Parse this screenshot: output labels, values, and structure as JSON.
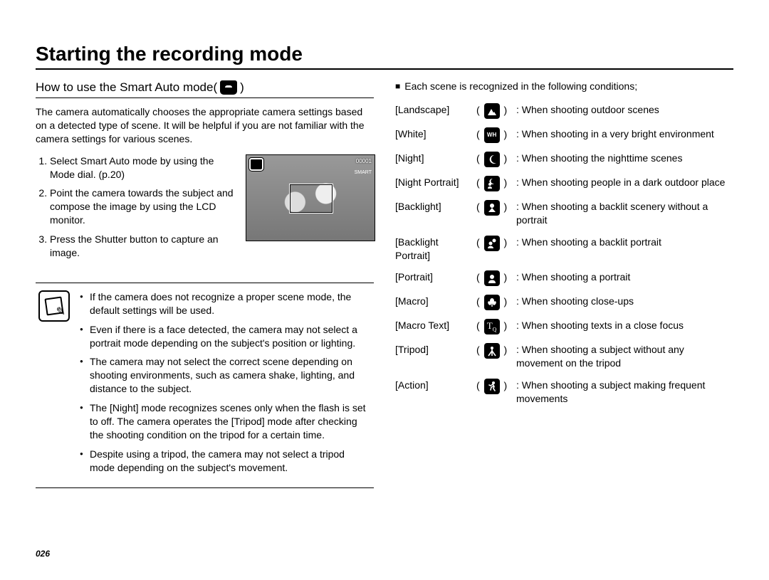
{
  "page_number": "026",
  "title": "Starting the recording mode",
  "left": {
    "subhead_prefix": "How to use the Smart Auto mode(",
    "subhead_suffix": ")",
    "intro": "The camera automatically chooses the appropriate camera settings based on a detected type of scene. It will be helpful if you are not familiar with the camera settings for various scenes.",
    "steps": [
      "Select Smart Auto mode by using the Mode dial. (p.20)",
      "Point the camera towards the subject and compose the image by using the LCD monitor.",
      "Press the Shutter button to capture an image."
    ],
    "lcd": {
      "top_left_icon": "smart-auto-icon",
      "top_right_text": "00001",
      "right_label": "SMART"
    },
    "notes": [
      "If the camera does not recognize a proper scene mode, the default settings will be used.",
      "Even if there is a face detected, the camera may not select a portrait mode depending on the subject's position or lighting.",
      "The camera may not select the correct scene depending on shooting environments, such as camera shake, lighting, and distance to the subject.",
      "The [Night] mode recognizes scenes only when the flash is set to off. The camera operates the [Tripod] mode after checking the shooting condition on the tripod for a certain time.",
      "Despite using a tripod, the camera may not select a tripod mode depending on the subject's movement."
    ]
  },
  "right": {
    "heading": "Each scene is recognized in the following conditions;",
    "scenes": [
      {
        "label": "[Landscape]",
        "icon": "landscape",
        "desc": "When shooting outdoor scenes"
      },
      {
        "label": "[White]",
        "icon": "white",
        "desc": "When shooting in a very bright environment"
      },
      {
        "label": "[Night]",
        "icon": "night",
        "desc": "When shooting the nighttime scenes"
      },
      {
        "label": "[Night Portrait]",
        "icon": "night-portrait",
        "desc": "When shooting people in a dark outdoor place"
      },
      {
        "label": "[Backlight]",
        "icon": "backlight",
        "desc": "When shooting a backlit scenery without a portrait"
      },
      {
        "label": "[Backlight Portrait]",
        "icon": "backlight-portrait",
        "desc": "When shooting a backlit portrait"
      },
      {
        "label": "[Portrait]",
        "icon": "portrait",
        "desc": "When shooting a portrait"
      },
      {
        "label": "[Macro]",
        "icon": "macro",
        "desc": "When shooting close-ups"
      },
      {
        "label": "[Macro Text]",
        "icon": "macro-text",
        "desc": "When shooting texts in a close focus"
      },
      {
        "label": "[Tripod]",
        "icon": "tripod",
        "desc": "When shooting a subject without any movement on the tripod"
      },
      {
        "label": "[Action]",
        "icon": "action",
        "desc": "When shooting a subject making frequent movements"
      }
    ]
  }
}
